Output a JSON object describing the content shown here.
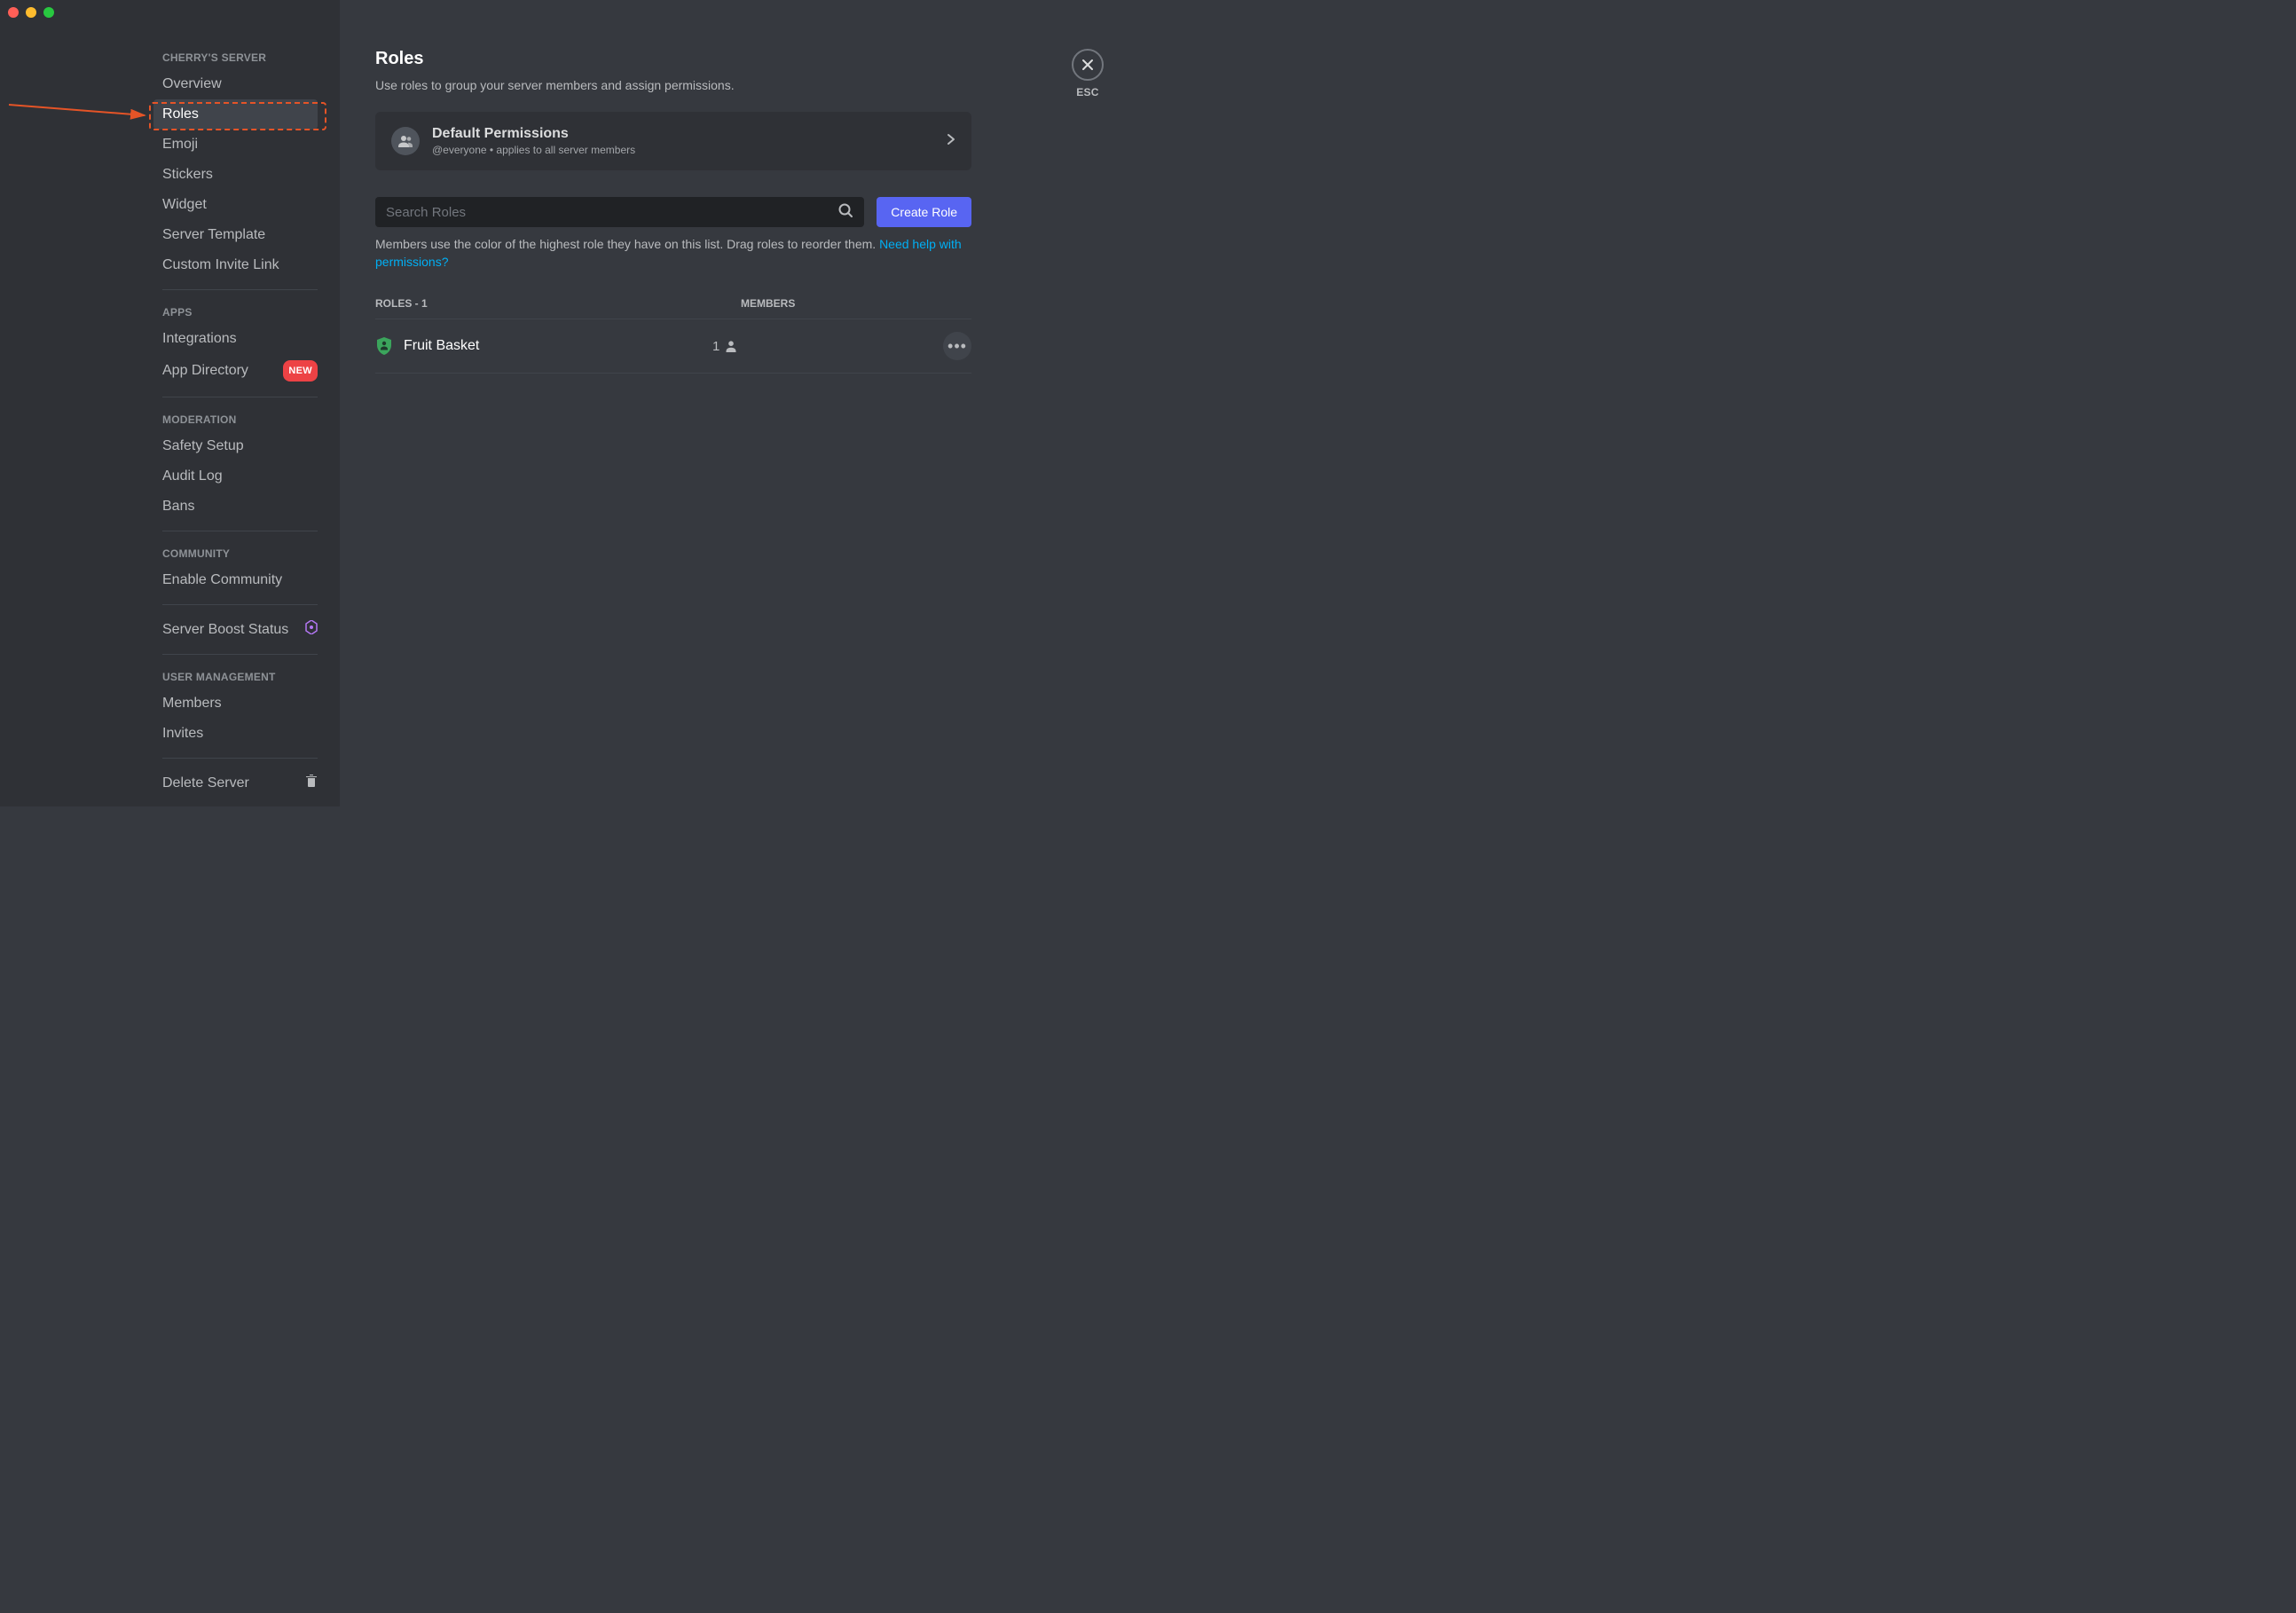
{
  "sidebar": {
    "server_name_header": "CHERRY'S SERVER",
    "items_server": [
      {
        "label": "Overview"
      },
      {
        "label": "Roles"
      },
      {
        "label": "Emoji"
      },
      {
        "label": "Stickers"
      },
      {
        "label": "Widget"
      },
      {
        "label": "Server Template"
      },
      {
        "label": "Custom Invite Link"
      }
    ],
    "apps_header": "APPS",
    "items_apps": [
      {
        "label": "Integrations"
      },
      {
        "label": "App Directory",
        "badge": "NEW"
      }
    ],
    "moderation_header": "MODERATION",
    "items_moderation": [
      {
        "label": "Safety Setup"
      },
      {
        "label": "Audit Log"
      },
      {
        "label": "Bans"
      }
    ],
    "community_header": "COMMUNITY",
    "items_community": [
      {
        "label": "Enable Community"
      }
    ],
    "boost_label": "Server Boost Status",
    "user_mgmt_header": "USER MANAGEMENT",
    "items_user": [
      {
        "label": "Members"
      },
      {
        "label": "Invites"
      }
    ],
    "delete_label": "Delete Server"
  },
  "close_label": "ESC",
  "page": {
    "title": "Roles",
    "subtitle": "Use roles to group your server members and assign permissions."
  },
  "perm_card": {
    "title": "Default Permissions",
    "subtitle": "@everyone • applies to all server members"
  },
  "search": {
    "placeholder": "Search Roles"
  },
  "create_button": "Create Role",
  "hint": {
    "text": "Members use the color of the highest role they have on this list. Drag roles to reorder them. ",
    "link": "Need help with permissions?"
  },
  "table": {
    "roles_count": 1,
    "roles_header": "ROLES - 1",
    "members_header": "MEMBERS"
  },
  "roles": [
    {
      "name": "Fruit Basket",
      "member_count": 1,
      "color": "#3ba55c"
    }
  ]
}
